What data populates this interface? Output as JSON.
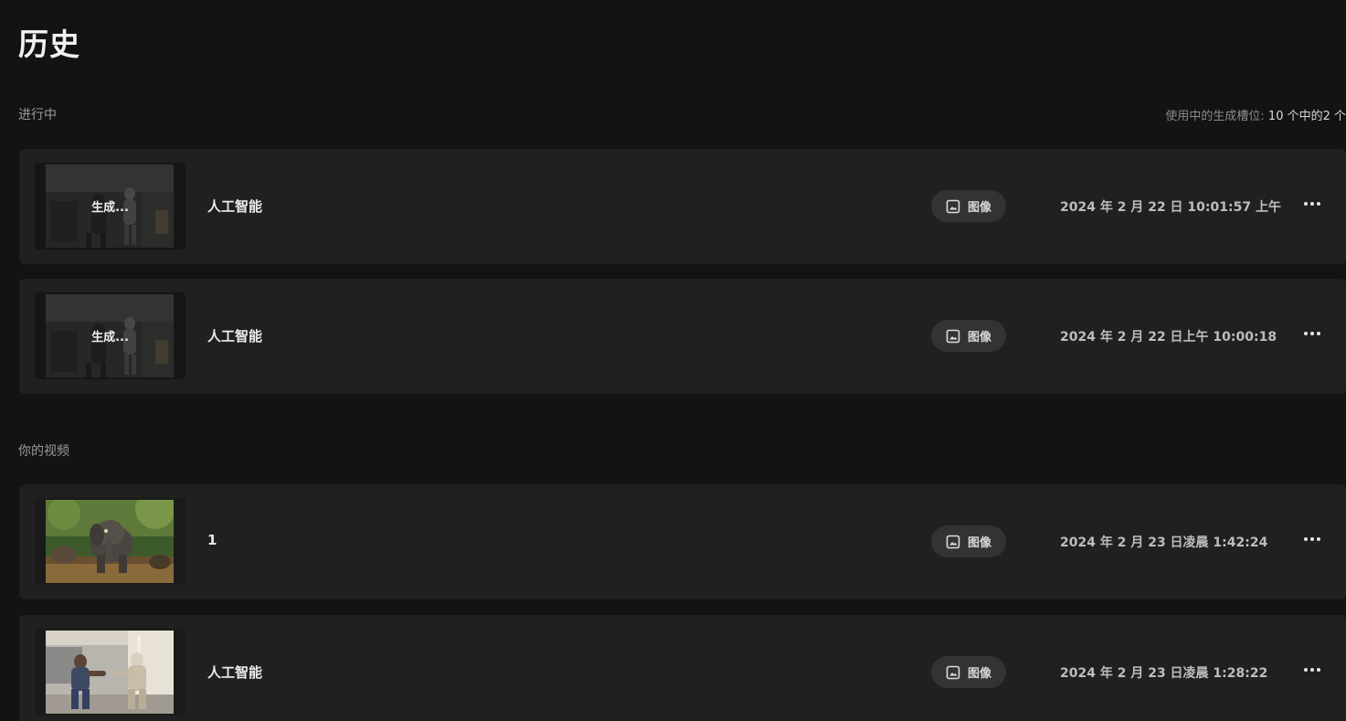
{
  "page": {
    "title": "历史"
  },
  "in_progress": {
    "label": "进行中",
    "slot_info_prefix": "使用中的生成槽位:",
    "slot_info_count": "10 个中的2 个",
    "items": [
      {
        "thumb_status": "生成...",
        "title": "人工智能",
        "type": "图像",
        "date": "2024 年 2 月 22 日 10:01:57 上午"
      },
      {
        "thumb_status": "生成...",
        "title": "人工智能",
        "type": "图像",
        "date": "2024 年 2 月 22 日上午 10:00:18"
      }
    ]
  },
  "videos": {
    "label": "你的视频",
    "items": [
      {
        "title": "1",
        "type": "图像",
        "date": "2024 年 2 月 23 日凌晨 1:42:24"
      },
      {
        "title": "人工智能",
        "type": "图像",
        "date": "2024 年 2 月 23 日凌晨 1:28:22"
      }
    ]
  },
  "icons": {
    "type": "image-icon",
    "more": "more-horizontal-icon"
  },
  "colors": {
    "background": "#131313",
    "row": "#202020",
    "badge": "#333333"
  }
}
